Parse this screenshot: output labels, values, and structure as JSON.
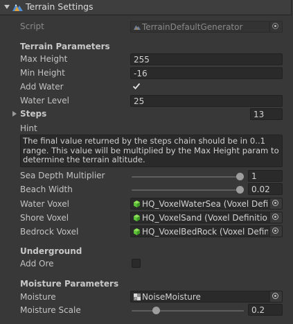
{
  "header": {
    "title": "Terrain Settings"
  },
  "script_row": {
    "label": "Script",
    "value": "TerrainDefaultGenerator"
  },
  "terrain_parameters": {
    "heading": "Terrain Parameters",
    "max_height": {
      "label": "Max Height",
      "value": "255"
    },
    "min_height": {
      "label": "Min Height",
      "value": "-16"
    },
    "add_water": {
      "label": "Add Water",
      "checked": true
    },
    "water_level": {
      "label": "Water Level",
      "value": "25"
    }
  },
  "steps": {
    "label": "Steps",
    "value": "13"
  },
  "hint": {
    "label": "Hint",
    "text": "The final value returned by the steps chain should be in 0..1 range. This value will be multiplied by the Max Height param to determine the terrain altitude."
  },
  "sea_depth_multiplier": {
    "label": "Sea Depth Multiplier",
    "value": "1",
    "fraction": 1.0
  },
  "beach_width": {
    "label": "Beach Width",
    "value": "0.02",
    "fraction": 1.0
  },
  "water_voxel": {
    "label": "Water Voxel",
    "value": "HQ_VoxelWaterSea (Voxel Definition)"
  },
  "shore_voxel": {
    "label": "Shore Voxel",
    "value": "HQ_VoxelSand (Voxel Definition)"
  },
  "bedrock_voxel": {
    "label": "Bedrock Voxel",
    "value": "HQ_VoxelBedRock (Voxel Definition)"
  },
  "underground": {
    "heading": "Underground",
    "add_ore": {
      "label": "Add Ore",
      "checked": false
    }
  },
  "moisture_parameters": {
    "heading": "Moisture Parameters",
    "moisture": {
      "label": "Moisture",
      "value": "NoiseMoisture"
    },
    "moisture_scale": {
      "label": "Moisture Scale",
      "value": "0.2",
      "fraction": 0.2
    }
  },
  "colors": {
    "background": "#383838",
    "field_bg": "#2a2a2a",
    "voxel_icon": "#5fc43a",
    "slider_knob": "#9d9d9d"
  },
  "icons": {
    "header_toggle": "chevron-down-icon",
    "component": "terrain-mountain-icon",
    "object_picker": "object-picker-icon",
    "voxel_asset": "voxel-cube-icon",
    "texture_asset": "texture-icon"
  }
}
